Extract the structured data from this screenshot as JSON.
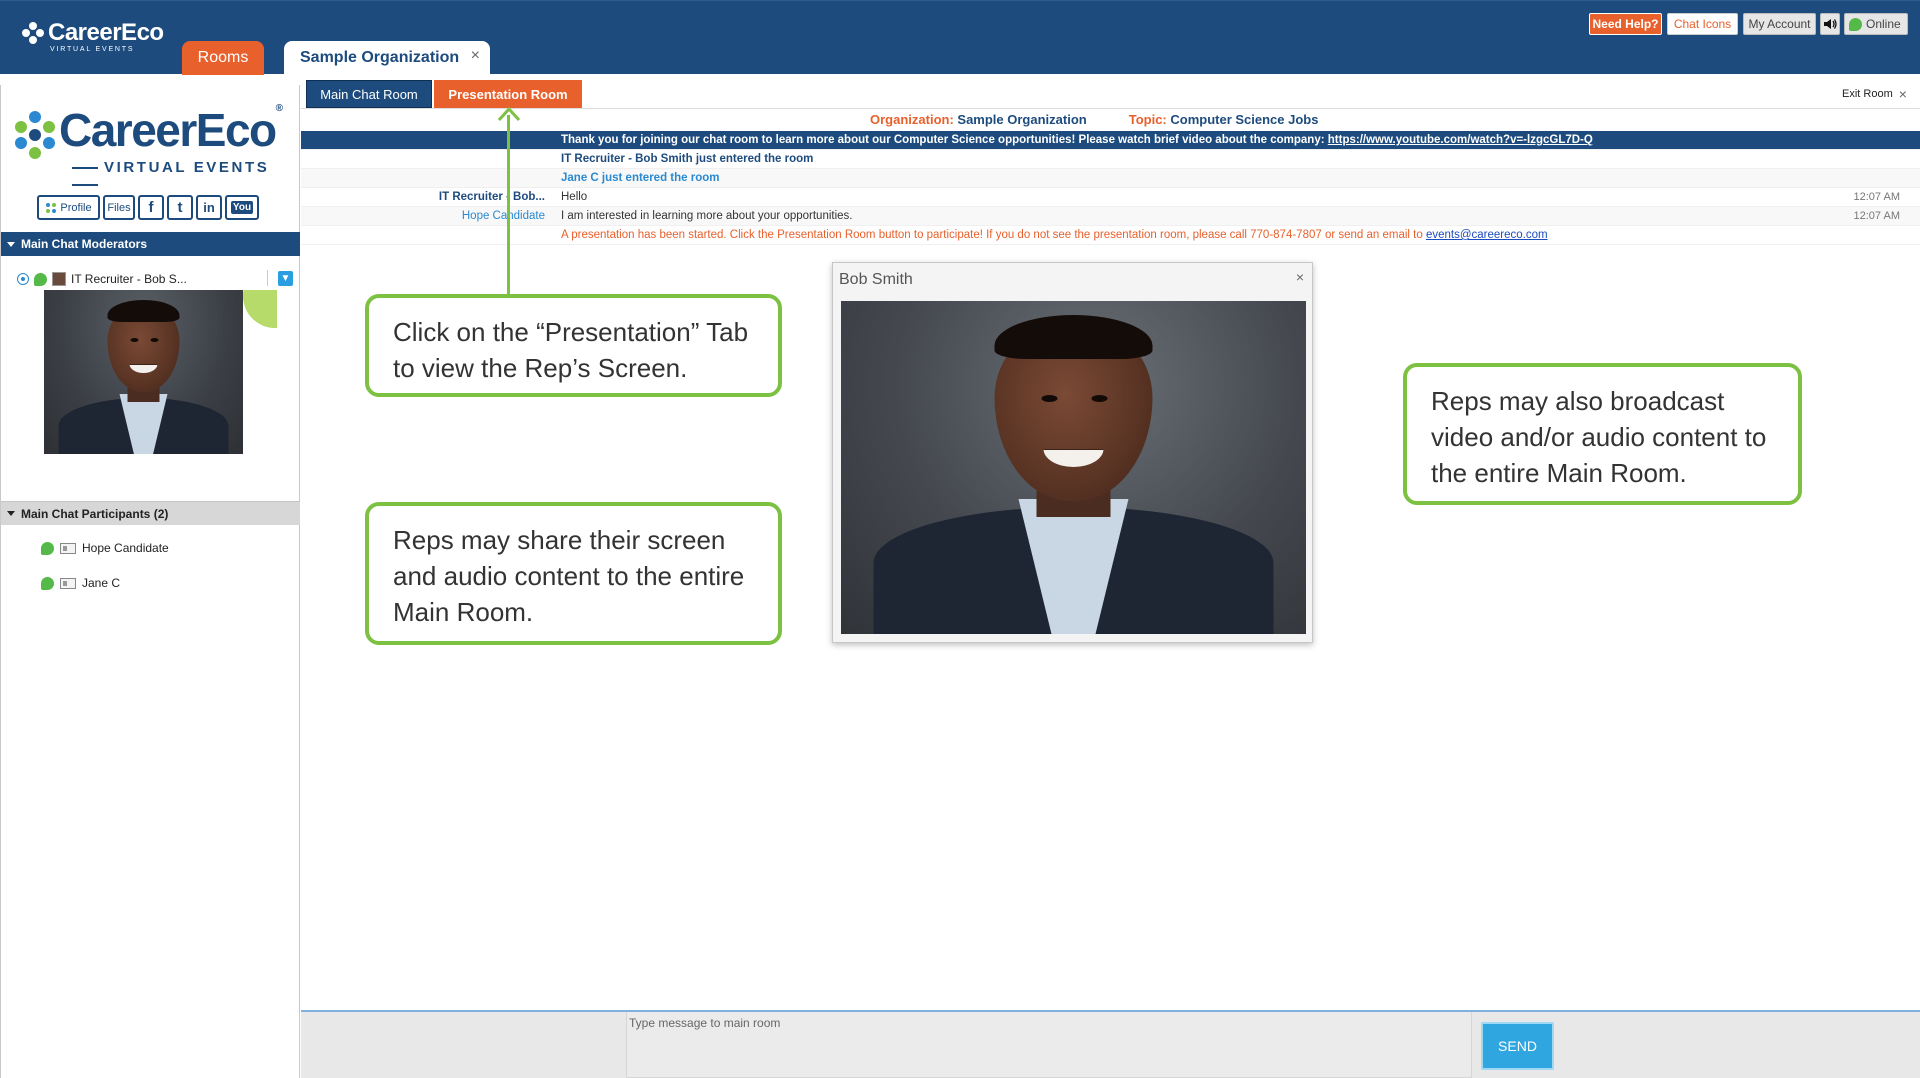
{
  "app": {
    "logo_text": "CareerEco",
    "logo_sub": "VIRTUAL EVENTS",
    "logo_reg": "®"
  },
  "top_tabs": [
    {
      "label": "Rooms"
    },
    {
      "label": "Sample Organization",
      "close": "×"
    }
  ],
  "header_buttons": {
    "help": "Need Help?",
    "chat_icons": "Chat Icons",
    "account": "My Account",
    "online": "Online"
  },
  "sidebar": {
    "social": {
      "profile": "Profile",
      "files": "Files",
      "facebook": "f",
      "twitter": "t",
      "linkedin": "in",
      "youtube": "You"
    },
    "moderators": {
      "title": "Main Chat Moderators",
      "items": [
        {
          "name": "IT Recruiter - Bob S..."
        }
      ]
    },
    "participants": {
      "title": "Main Chat Participants (2)",
      "items": [
        {
          "name": "Hope Candidate"
        },
        {
          "name": "Jane C"
        }
      ]
    }
  },
  "room_tabs": {
    "main": "Main Chat Room",
    "presentation": "Presentation Room",
    "exit": "Exit Room",
    "exit_icon": "×"
  },
  "info": {
    "org_label": "Organization:",
    "org_value": "Sample Organization",
    "topic_label": "Topic:",
    "topic_value": "Computer Science Jobs"
  },
  "chat": {
    "banner_text": "Thank you for joining our chat room to learn more about our Computer Science opportunities! Please watch brief video about the company: ",
    "banner_link": "https://www.youtube.com/watch?v=-lzgcGL7D-Q",
    "sys1": "IT Recruiter - Bob Smith just entered the room",
    "sys2": "Jane C just entered the room",
    "messages": [
      {
        "who": "IT Recruiter - Bob...",
        "text": "Hello",
        "time": "12:07 AM"
      },
      {
        "who": "Hope Candidate",
        "text": "I am interested in learning more about your opportunities.",
        "time": "12:07 AM"
      }
    ],
    "alert_text": "A presentation has been started. Click the Presentation Room button to participate! If you do not see the presentation room, please call 770-874-7807 or send an email to ",
    "alert_link": "events@careereco.com"
  },
  "callouts": {
    "c1": "Click on the “Presentation” Tab to view the Rep’s Screen.",
    "c2": "Reps may share their screen and audio content to the entire Main Room.",
    "c3": "Reps may also broadcast video and/or audio content to the entire Main Room."
  },
  "video": {
    "title": "Bob Smith",
    "close": "×"
  },
  "composer": {
    "placeholder": "Type message to main room",
    "send": "SEND"
  },
  "colors": {
    "navy": "#1d4b7d",
    "orange": "#e8602c",
    "green": "#7dc143",
    "blue": "#2a89d0"
  }
}
